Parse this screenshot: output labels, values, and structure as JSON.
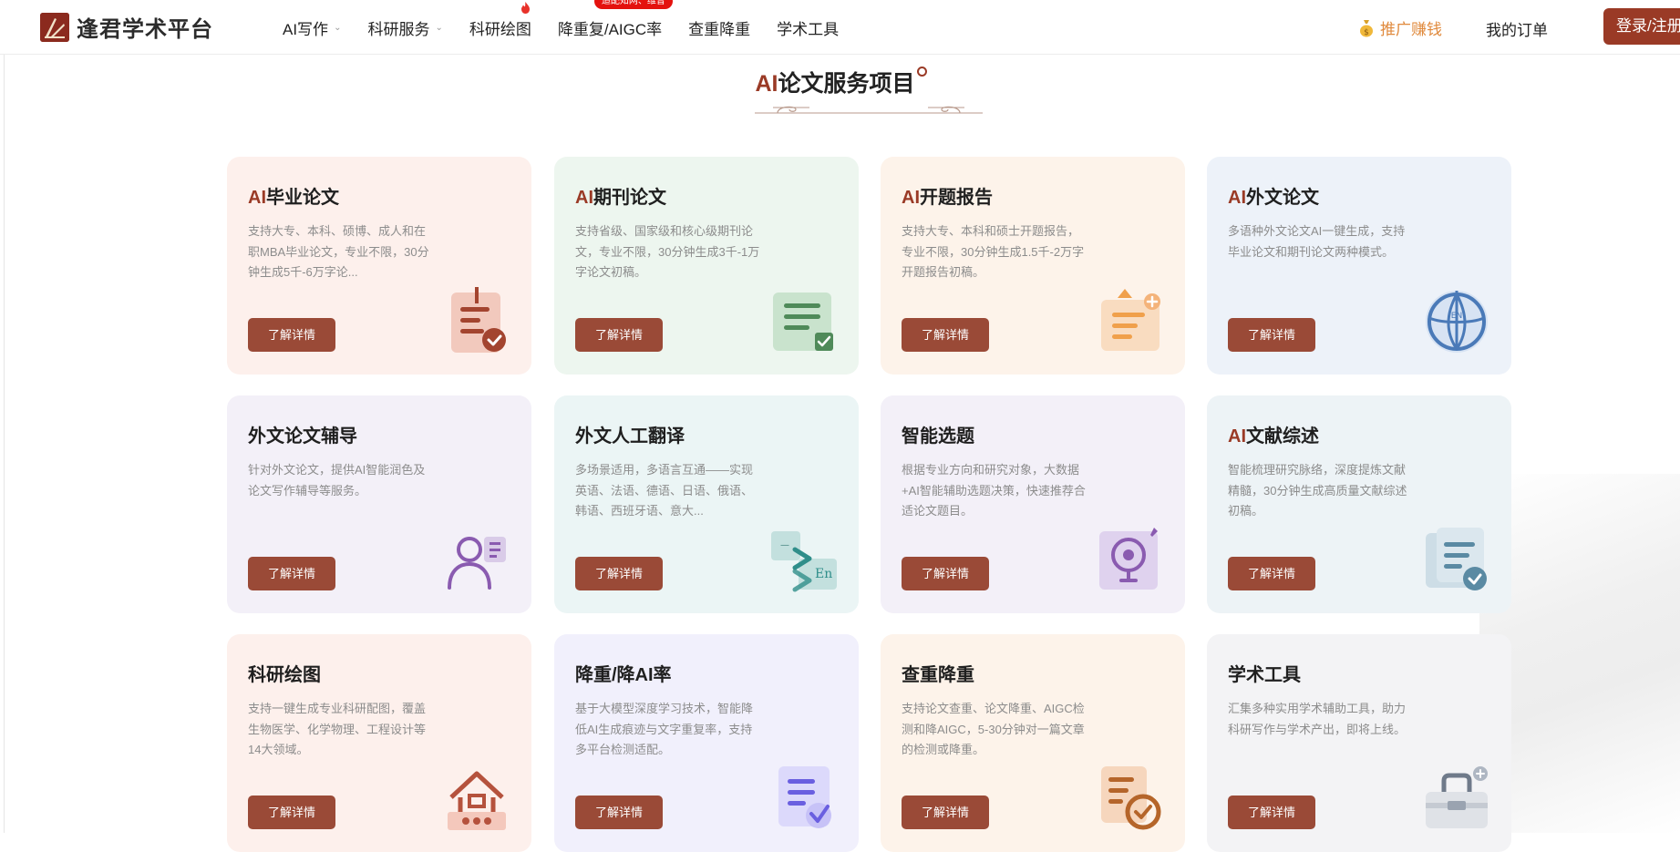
{
  "header": {
    "logo_text": "逢君学术平台",
    "nav": [
      {
        "label": "AI写作",
        "dropdown": true
      },
      {
        "label": "科研服务",
        "dropdown": true
      },
      {
        "label": "科研绘图",
        "dropdown": false
      },
      {
        "label": "降重复/AIGC率",
        "dropdown": false,
        "badge": "适配知网、维普"
      },
      {
        "label": "查重降重",
        "dropdown": false
      },
      {
        "label": "学术工具",
        "dropdown": false
      }
    ],
    "promo_label": "推广赚钱",
    "orders_label": "我的订单",
    "login_label": "登录/注册"
  },
  "section": {
    "title_prefix": "AI",
    "title_rest": "论文服务项目"
  },
  "cards": [
    {
      "prefix": "AI",
      "title": "毕业论文",
      "desc": "支持大专、本科、硕博、成人和在职MBA毕业论文，专业不限，30分钟生成5千-6万字论...",
      "button": "了解详情",
      "bg": "#fdf0ec",
      "icon": "thesis-document-check-icon"
    },
    {
      "prefix": "AI",
      "title": "期刊论文",
      "desc": "支持省级、国家级和核心级期刊论文，专业不限，30分钟生成3千-1万字论文初稿。",
      "button": "了解详情",
      "bg": "#edf6ef",
      "icon": "journal-list-check-icon"
    },
    {
      "prefix": "AI",
      "title": "开题报告",
      "desc": "支持大专、本科和硕士开题报告，专业不限，30分钟生成1.5千-2万字开题报告初稿。",
      "button": "了解详情",
      "bg": "#fdf3ea",
      "icon": "proposal-report-icon"
    },
    {
      "prefix": "AI",
      "title": "外文论文",
      "desc": "多语种外文论文AI一键生成，支持毕业论文和期刊论文两种模式。",
      "button": "了解详情",
      "bg": "#edf2f9",
      "icon": "globe-language-icon"
    },
    {
      "prefix": "",
      "title": "外文论文辅导",
      "desc": "针对外文论文，提供AI智能润色及论文写作辅导等服务。",
      "button": "了解详情",
      "bg": "#f3f0f8",
      "icon": "tutor-person-icon"
    },
    {
      "prefix": "",
      "title": "外文人工翻译",
      "desc": "多场景适用，多语言互通——实现英语、法语、德语、日语、俄语、韩语、西班牙语、意大...",
      "button": "了解详情",
      "bg": "#ebf5f5",
      "icon": "translate-en-icon"
    },
    {
      "prefix": "",
      "title": "智能选题",
      "desc": "根据专业方向和研究对象，大数据+AI智能辅助选题决策，快速推荐合适论文题目。",
      "button": "了解详情",
      "bg": "#f3f0f8",
      "icon": "smart-topic-webcam-icon"
    },
    {
      "prefix": "AI",
      "title": "文献综述",
      "desc": "智能梳理研究脉络，深度提炼文献精髓，30分钟生成高质量文献综述初稿。",
      "button": "了解详情",
      "bg": "#edf3f6",
      "icon": "literature-review-check-icon"
    },
    {
      "prefix": "",
      "title": "科研绘图",
      "desc": "支持一键生成专业科研配图，覆盖生物医学、化学物理、工程设计等14大领域。",
      "button": "了解详情",
      "bg": "#fdf0ec",
      "icon": "research-drawing-house-icon"
    },
    {
      "prefix": "",
      "title": "降重/降AI率",
      "desc": "基于大模型深度学习技术，智能降低AI生成痕迹与文字重复率，支持多平台检测适配。",
      "button": "了解详情",
      "bg": "#f1f0fc",
      "icon": "rewrite-check-icon"
    },
    {
      "prefix": "",
      "title": "查重降重",
      "desc": "支持论文查重、论文降重、AIGC检测和降AIGC，5-30分钟对一篇文章的检测或降重。",
      "button": "了解详情",
      "bg": "#fdf3ea",
      "icon": "plagiarism-check-icon"
    },
    {
      "prefix": "",
      "title": "学术工具",
      "desc": "汇集多种实用学术辅助工具，助力科研写作与学术产出，即将上线。",
      "button": "了解详情",
      "bg": "#f3f3f5",
      "icon": "toolbox-icon"
    }
  ],
  "colors": {
    "brand": "#9a3a26",
    "button": "#9a4a37",
    "promo": "#e08a3d",
    "hot_badge": "#e4120e"
  }
}
